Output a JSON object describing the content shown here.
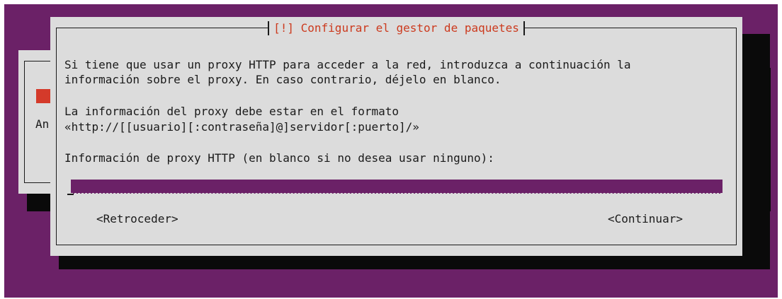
{
  "background_dialog": {
    "partial_text": "An"
  },
  "dialog": {
    "title": "[!] Configurar el gestor de paquetes",
    "intro_line1": "Si tiene que usar un proxy HTTP para acceder a la red, introduzca a continuación la",
    "intro_line2": "información sobre el proxy. En caso contrario, déjelo en blanco.",
    "format_line1": "La información del proxy debe estar en el formato",
    "format_line2": "«http://[[usuario][:contraseña]@]servidor[:puerto]/»",
    "field_label": "Información de proxy HTTP (en blanco si no desea usar ninguno):",
    "proxy_input_value": "",
    "back_button": "<Retroceder>",
    "continue_button": "<Continuar>"
  },
  "colors": {
    "desktop": "#6b2167",
    "dialog": "#dcdcdc",
    "title": "#cc3a1e",
    "shadow": "#0a0a0a",
    "accent_red": "#d43a2a"
  }
}
